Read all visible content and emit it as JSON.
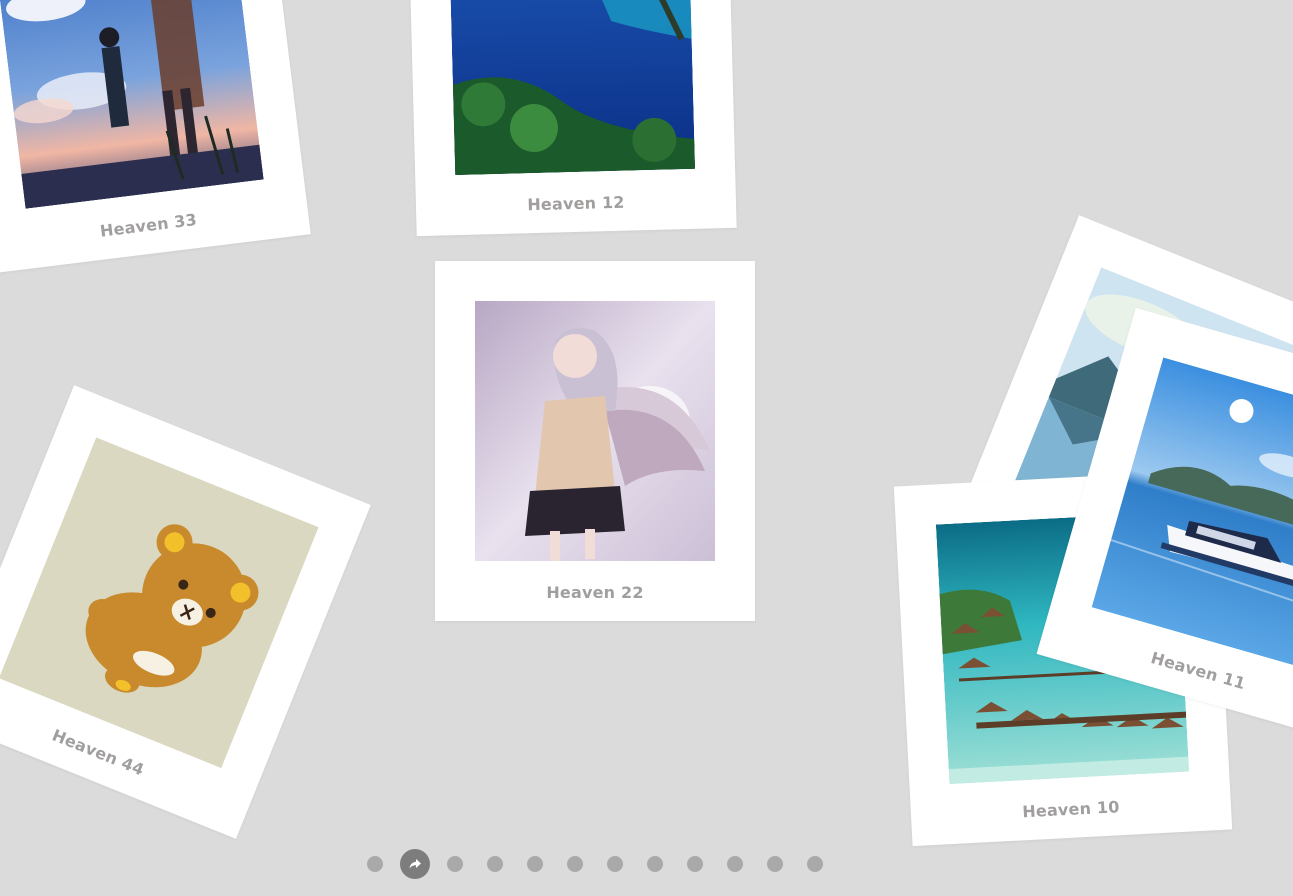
{
  "photos": [
    {
      "id": "p33",
      "caption": "Heaven 33",
      "scene": "anime-sky-students"
    },
    {
      "id": "p12",
      "caption": "Heaven 12",
      "scene": "tropical-coast"
    },
    {
      "id": "p22",
      "caption": "Heaven 22",
      "scene": "anime-angel-girl"
    },
    {
      "id": "p44",
      "caption": "Heaven 44",
      "scene": "rilakkuma-bear"
    },
    {
      "id": "p11b",
      "caption": "",
      "scene": "mountain-lake"
    },
    {
      "id": "p10",
      "caption": "Heaven 10",
      "scene": "overwater-bungalows"
    },
    {
      "id": "p11",
      "caption": "Heaven 11",
      "scene": "yacht-sea"
    }
  ],
  "nav": {
    "count": 12,
    "active_index": 1,
    "active_icon": "share-arrow-icon"
  },
  "colors": {
    "background": "#dbdbdb",
    "card": "#ffffff",
    "caption": "#a19e9e",
    "dot": "#a9a9a9",
    "dot_active": "#7d7d7d"
  }
}
